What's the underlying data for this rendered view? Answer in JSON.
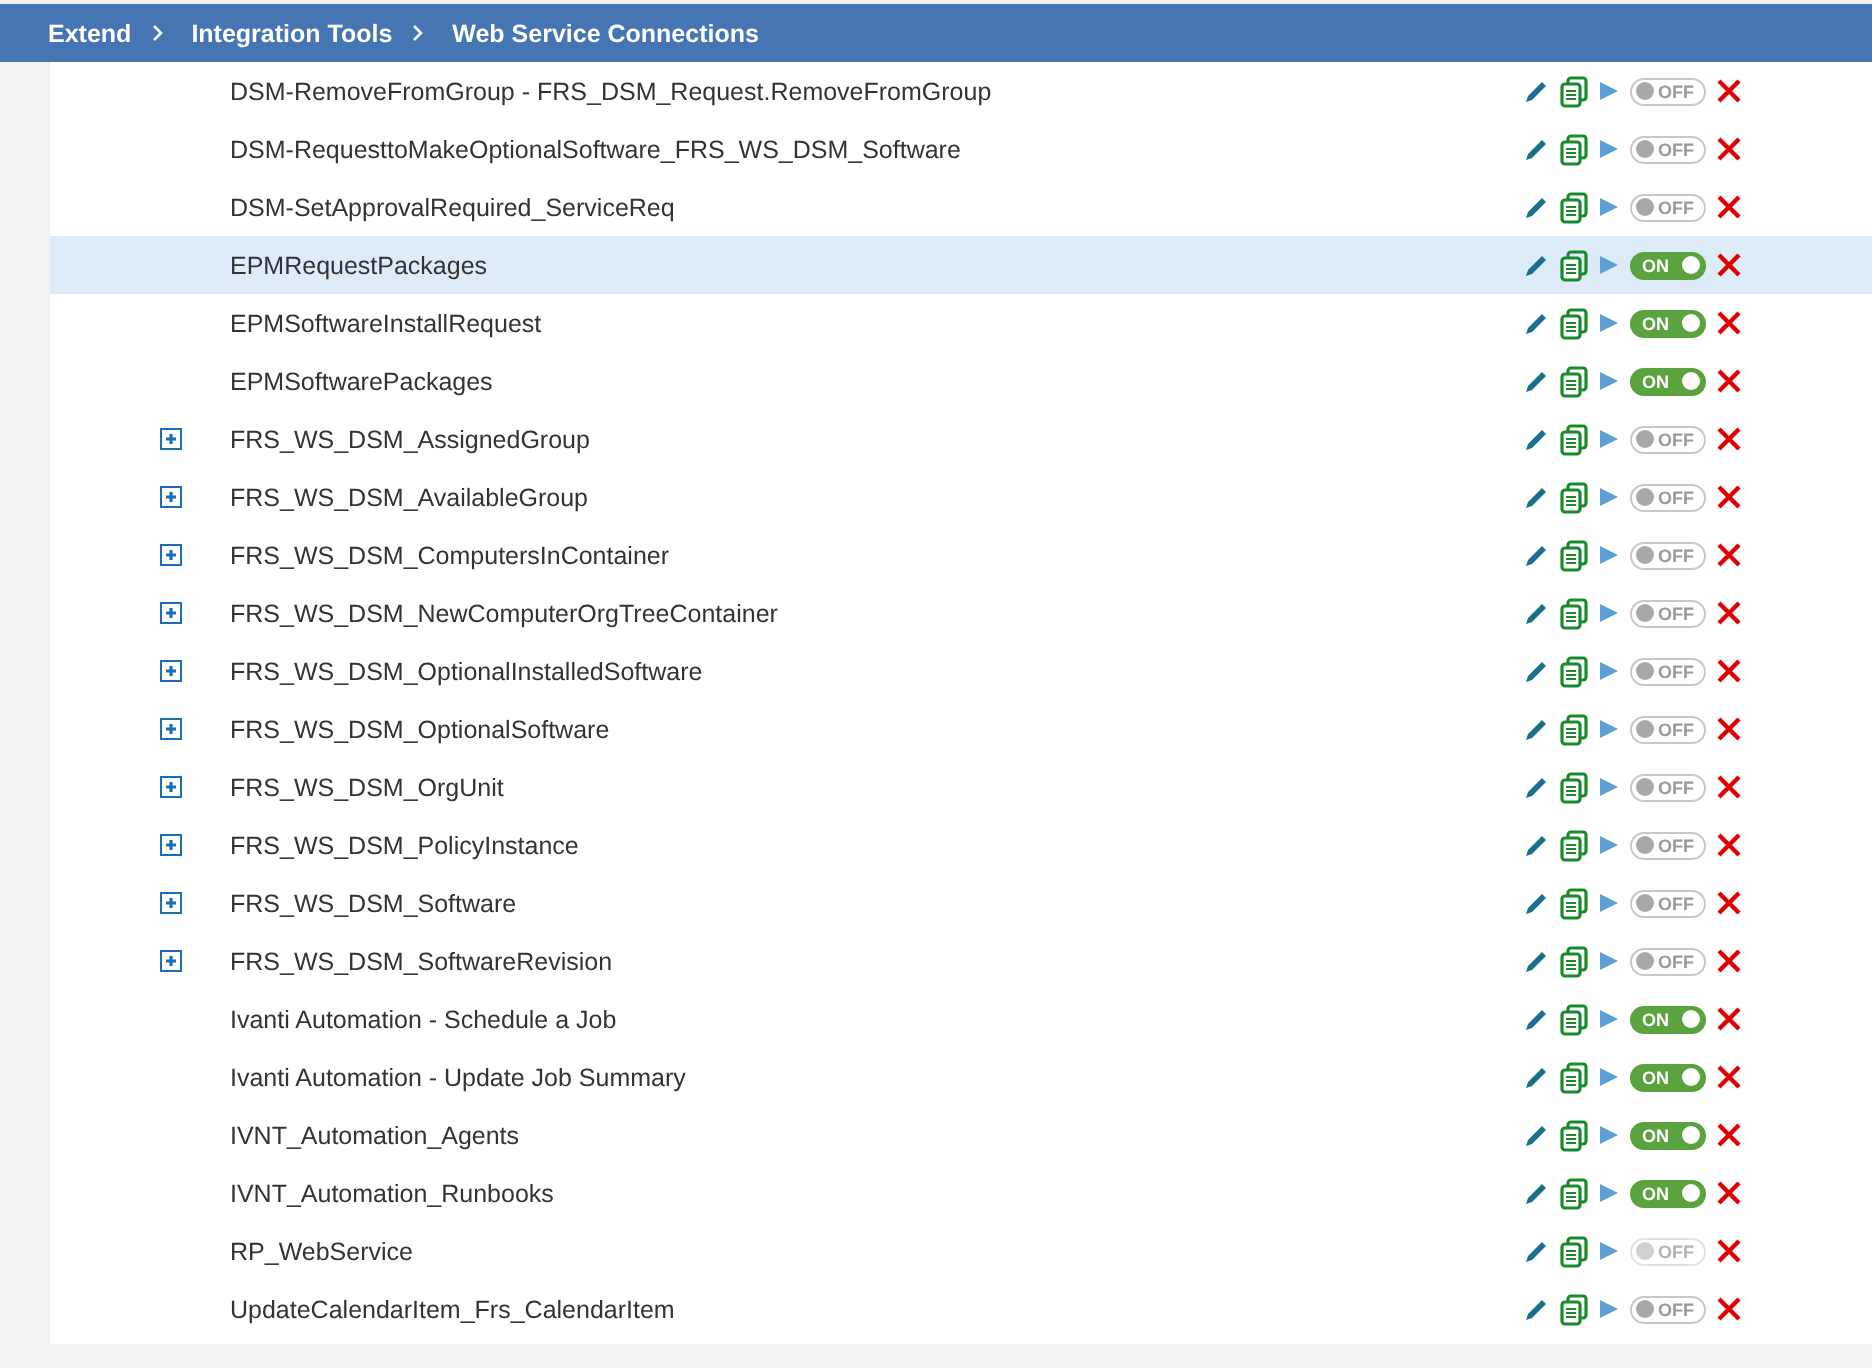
{
  "breadcrumbs": [
    {
      "label": "Extend"
    },
    {
      "label": "Integration Tools"
    },
    {
      "label": "Web Service Connections"
    }
  ],
  "rows": [
    {
      "name": "DSM-RemoveFromGroup - FRS_DSM_Request.RemoveFromGroup",
      "selected": false,
      "toggle": {
        "label": "OFF",
        "on": false,
        "disabled": false
      }
    },
    {
      "name": "DSM-RequesttoMakeOptionalSoftware_FRS_WS_DSM_Software",
      "selected": false,
      "toggle": {
        "label": "OFF",
        "on": false,
        "disabled": false
      }
    },
    {
      "name": "DSM-SetApprovalRequired_ServiceReq",
      "selected": false,
      "toggle": {
        "label": "OFF",
        "on": false,
        "disabled": false
      }
    },
    {
      "name": "EPMRequestPackages",
      "selected": true,
      "toggle": {
        "label": "ON",
        "on": true,
        "disabled": false
      }
    },
    {
      "name": "EPMSoftwareInstallRequest",
      "selected": false,
      "toggle": {
        "label": "ON",
        "on": true,
        "disabled": false
      }
    },
    {
      "name": "EPMSoftwarePackages",
      "selected": false,
      "toggle": {
        "label": "ON",
        "on": true,
        "disabled": false
      }
    },
    {
      "name": "FRS_WS_DSM_AssignedGroup",
      "selected": false,
      "expanded": false,
      "toggle": {
        "label": "OFF",
        "on": false,
        "disabled": false
      }
    },
    {
      "name": "FRS_WS_DSM_AvailableGroup",
      "selected": false,
      "expanded": false,
      "toggle": {
        "label": "OFF",
        "on": false,
        "disabled": false
      }
    },
    {
      "name": "FRS_WS_DSM_ComputersInContainer",
      "selected": false,
      "expanded": false,
      "toggle": {
        "label": "OFF",
        "on": false,
        "disabled": false
      }
    },
    {
      "name": "FRS_WS_DSM_NewComputerOrgTreeContainer",
      "selected": false,
      "expanded": false,
      "toggle": {
        "label": "OFF",
        "on": false,
        "disabled": false
      }
    },
    {
      "name": "FRS_WS_DSM_OptionalInstalledSoftware",
      "selected": false,
      "expanded": false,
      "toggle": {
        "label": "OFF",
        "on": false,
        "disabled": false
      }
    },
    {
      "name": "FRS_WS_DSM_OptionalSoftware",
      "selected": false,
      "expanded": false,
      "toggle": {
        "label": "OFF",
        "on": false,
        "disabled": false
      }
    },
    {
      "name": "FRS_WS_DSM_OrgUnit",
      "selected": false,
      "expanded": false,
      "toggle": {
        "label": "OFF",
        "on": false,
        "disabled": false
      }
    },
    {
      "name": "FRS_WS_DSM_PolicyInstance",
      "selected": false,
      "expanded": false,
      "toggle": {
        "label": "OFF",
        "on": false,
        "disabled": false
      }
    },
    {
      "name": "FRS_WS_DSM_Software",
      "selected": false,
      "expanded": false,
      "toggle": {
        "label": "OFF",
        "on": false,
        "disabled": false
      }
    },
    {
      "name": "FRS_WS_DSM_SoftwareRevision",
      "selected": false,
      "expanded": false,
      "toggle": {
        "label": "OFF",
        "on": false,
        "disabled": false
      }
    },
    {
      "name": "Ivanti Automation - Schedule a Job",
      "selected": false,
      "toggle": {
        "label": "ON",
        "on": true,
        "disabled": false
      }
    },
    {
      "name": "Ivanti Automation - Update Job Summary",
      "selected": false,
      "toggle": {
        "label": "ON",
        "on": true,
        "disabled": false
      }
    },
    {
      "name": "IVNT_Automation_Agents",
      "selected": false,
      "toggle": {
        "label": "ON",
        "on": true,
        "disabled": false
      }
    },
    {
      "name": "IVNT_Automation_Runbooks",
      "selected": false,
      "toggle": {
        "label": "ON",
        "on": true,
        "disabled": false
      }
    },
    {
      "name": "RP_WebService",
      "selected": false,
      "toggle": {
        "label": "OFF",
        "on": false,
        "disabled": true
      }
    },
    {
      "name": "UpdateCalendarItem_Frs_CalendarItem",
      "selected": false,
      "toggle": {
        "label": "OFF",
        "on": false,
        "disabled": false
      }
    }
  ]
}
